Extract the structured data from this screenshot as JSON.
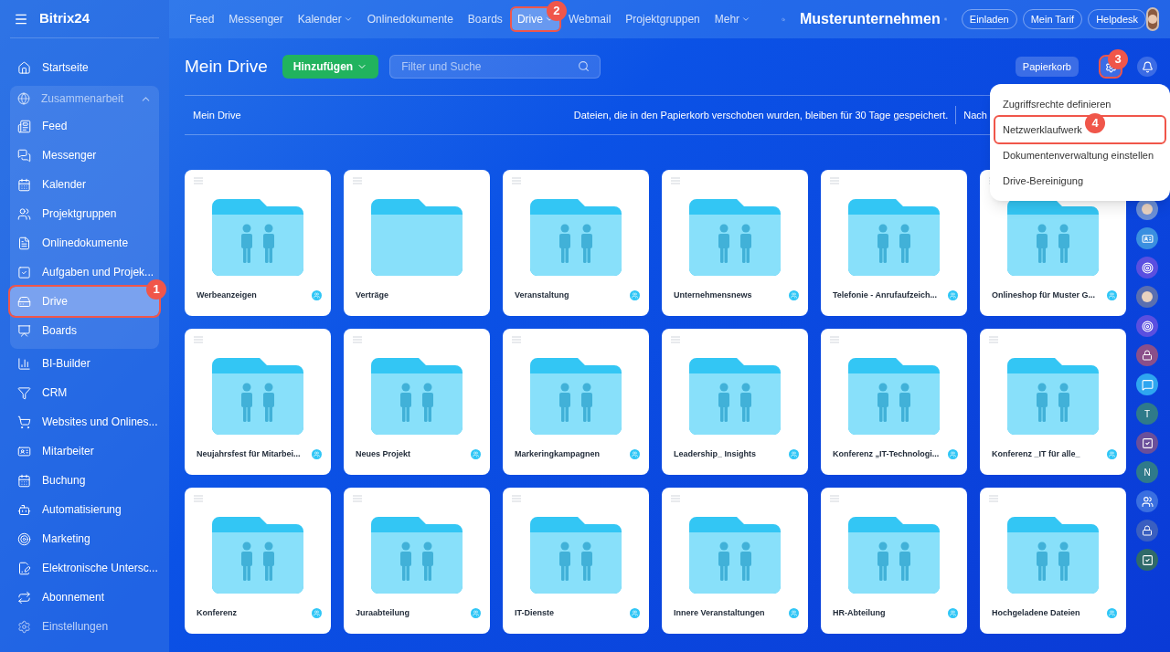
{
  "brand": {
    "name": "Bitrix24"
  },
  "topnav": [
    {
      "label": "Feed",
      "dropdown": false,
      "selected": false
    },
    {
      "label": "Messenger",
      "dropdown": false,
      "selected": false
    },
    {
      "label": "Kalender",
      "dropdown": true,
      "selected": false
    },
    {
      "label": "Onlinedokumente",
      "dropdown": false,
      "selected": false
    },
    {
      "label": "Boards",
      "dropdown": false,
      "selected": false
    },
    {
      "label": "Drive",
      "dropdown": true,
      "selected": true,
      "callout": "2"
    },
    {
      "label": "Webmail",
      "dropdown": false,
      "selected": false
    },
    {
      "label": "Projektgruppen",
      "dropdown": false,
      "selected": false
    },
    {
      "label": "Mehr",
      "dropdown": true,
      "selected": false
    }
  ],
  "company": "Musterunternehmen",
  "header_buttons": [
    "Einladen",
    "Mein Tarif",
    "Helpdesk"
  ],
  "sidebar": {
    "top": {
      "label": "Startseite"
    },
    "group": {
      "label": "Zusammenarbeit",
      "expanded": true,
      "items": [
        {
          "label": "Feed",
          "selected": false
        },
        {
          "label": "Messenger",
          "selected": false
        },
        {
          "label": "Kalender",
          "selected": false
        },
        {
          "label": "Projektgruppen",
          "selected": false
        },
        {
          "label": "Onlinedokumente",
          "selected": false
        },
        {
          "label": "Aufgaben und Projek...",
          "selected": false
        },
        {
          "label": "Drive",
          "selected": true,
          "callout": "1"
        },
        {
          "label": "Boards",
          "selected": false
        }
      ]
    },
    "items": [
      {
        "label": "BI-Builder"
      },
      {
        "label": "CRM"
      },
      {
        "label": "Websites und Onlines..."
      },
      {
        "label": "Mitarbeiter"
      },
      {
        "label": "Buchung"
      },
      {
        "label": "Automatisierung"
      },
      {
        "label": "Marketing"
      },
      {
        "label": "Elektronische Untersc..."
      },
      {
        "label": "Abonnement"
      }
    ],
    "settings": {
      "label": "Einstellungen"
    }
  },
  "page": {
    "title": "Mein Drive",
    "add_button": "Hinzufügen",
    "search": {
      "placeholder": "Filter und Suche"
    },
    "trash_button": "Papierkorb",
    "settings_callout": "3"
  },
  "breadcrumb": "Mein Drive",
  "notice": "Dateien, die in den Papierkorb verschoben wurden, bleiben für 30 Tage gespeichert.",
  "notice_tail": "Nach",
  "settings_menu": [
    {
      "label": "Zugriffsrechte definieren"
    },
    {
      "label": "Netzwerklaufwerk",
      "callout": "4"
    },
    {
      "label": "Dokumentenverwaltung einstellen"
    },
    {
      "label": "Drive-Bereinigung"
    }
  ],
  "folders": [
    {
      "name": "Werbeanzeigen",
      "kind": "shared"
    },
    {
      "name": "Verträge",
      "kind": "plain"
    },
    {
      "name": "Veranstaltung",
      "kind": "shared"
    },
    {
      "name": "Unternehmensnews",
      "kind": "shared"
    },
    {
      "name": "Telefonie - Anrufaufzeich...",
      "kind": "shared"
    },
    {
      "name": "Onlineshop für Muster G...",
      "kind": "shared"
    },
    {
      "name": "Neujahrsfest für Mitarbei...",
      "kind": "shared"
    },
    {
      "name": "Neues Projekt",
      "kind": "shared"
    },
    {
      "name": "Markeringkampagnen",
      "kind": "shared"
    },
    {
      "name": "Leadership_ Insights",
      "kind": "shared"
    },
    {
      "name": "Konferenz „IT-Technologi...",
      "kind": "shared"
    },
    {
      "name": "Konferenz _IT für alle_",
      "kind": "shared"
    },
    {
      "name": "Konferenz",
      "kind": "shared"
    },
    {
      "name": "Juraabteilung",
      "kind": "shared"
    },
    {
      "name": "IT-Dienste",
      "kind": "shared"
    },
    {
      "name": "Innere Veranstaltungen",
      "kind": "shared"
    },
    {
      "name": "HR-Abteilung",
      "kind": "shared"
    },
    {
      "name": "Hochgeladene Dateien",
      "kind": "shared"
    }
  ],
  "rail": [
    {
      "kind": "avatar",
      "color": "#6b8fd6"
    },
    {
      "kind": "card",
      "color": "#3a8fe0"
    },
    {
      "kind": "target",
      "color": "#5a4fe0"
    },
    {
      "kind": "avatar",
      "color": "#5a6fb0"
    },
    {
      "kind": "target",
      "color": "#5a4fe0"
    },
    {
      "kind": "lock",
      "color": "#8a4f8a"
    },
    {
      "kind": "chat",
      "color": "#2ea6f0"
    },
    {
      "kind": "letter",
      "color": "#2f7a8a",
      "letter": "T"
    },
    {
      "kind": "check",
      "color": "#6a4f9a"
    },
    {
      "kind": "letter",
      "color": "#2f7a8a",
      "letter": "N"
    },
    {
      "kind": "group",
      "color": "#3a6fe0"
    },
    {
      "kind": "lock",
      "color": "#3a5fc0"
    },
    {
      "kind": "check",
      "color": "#2f6a6a"
    }
  ]
}
